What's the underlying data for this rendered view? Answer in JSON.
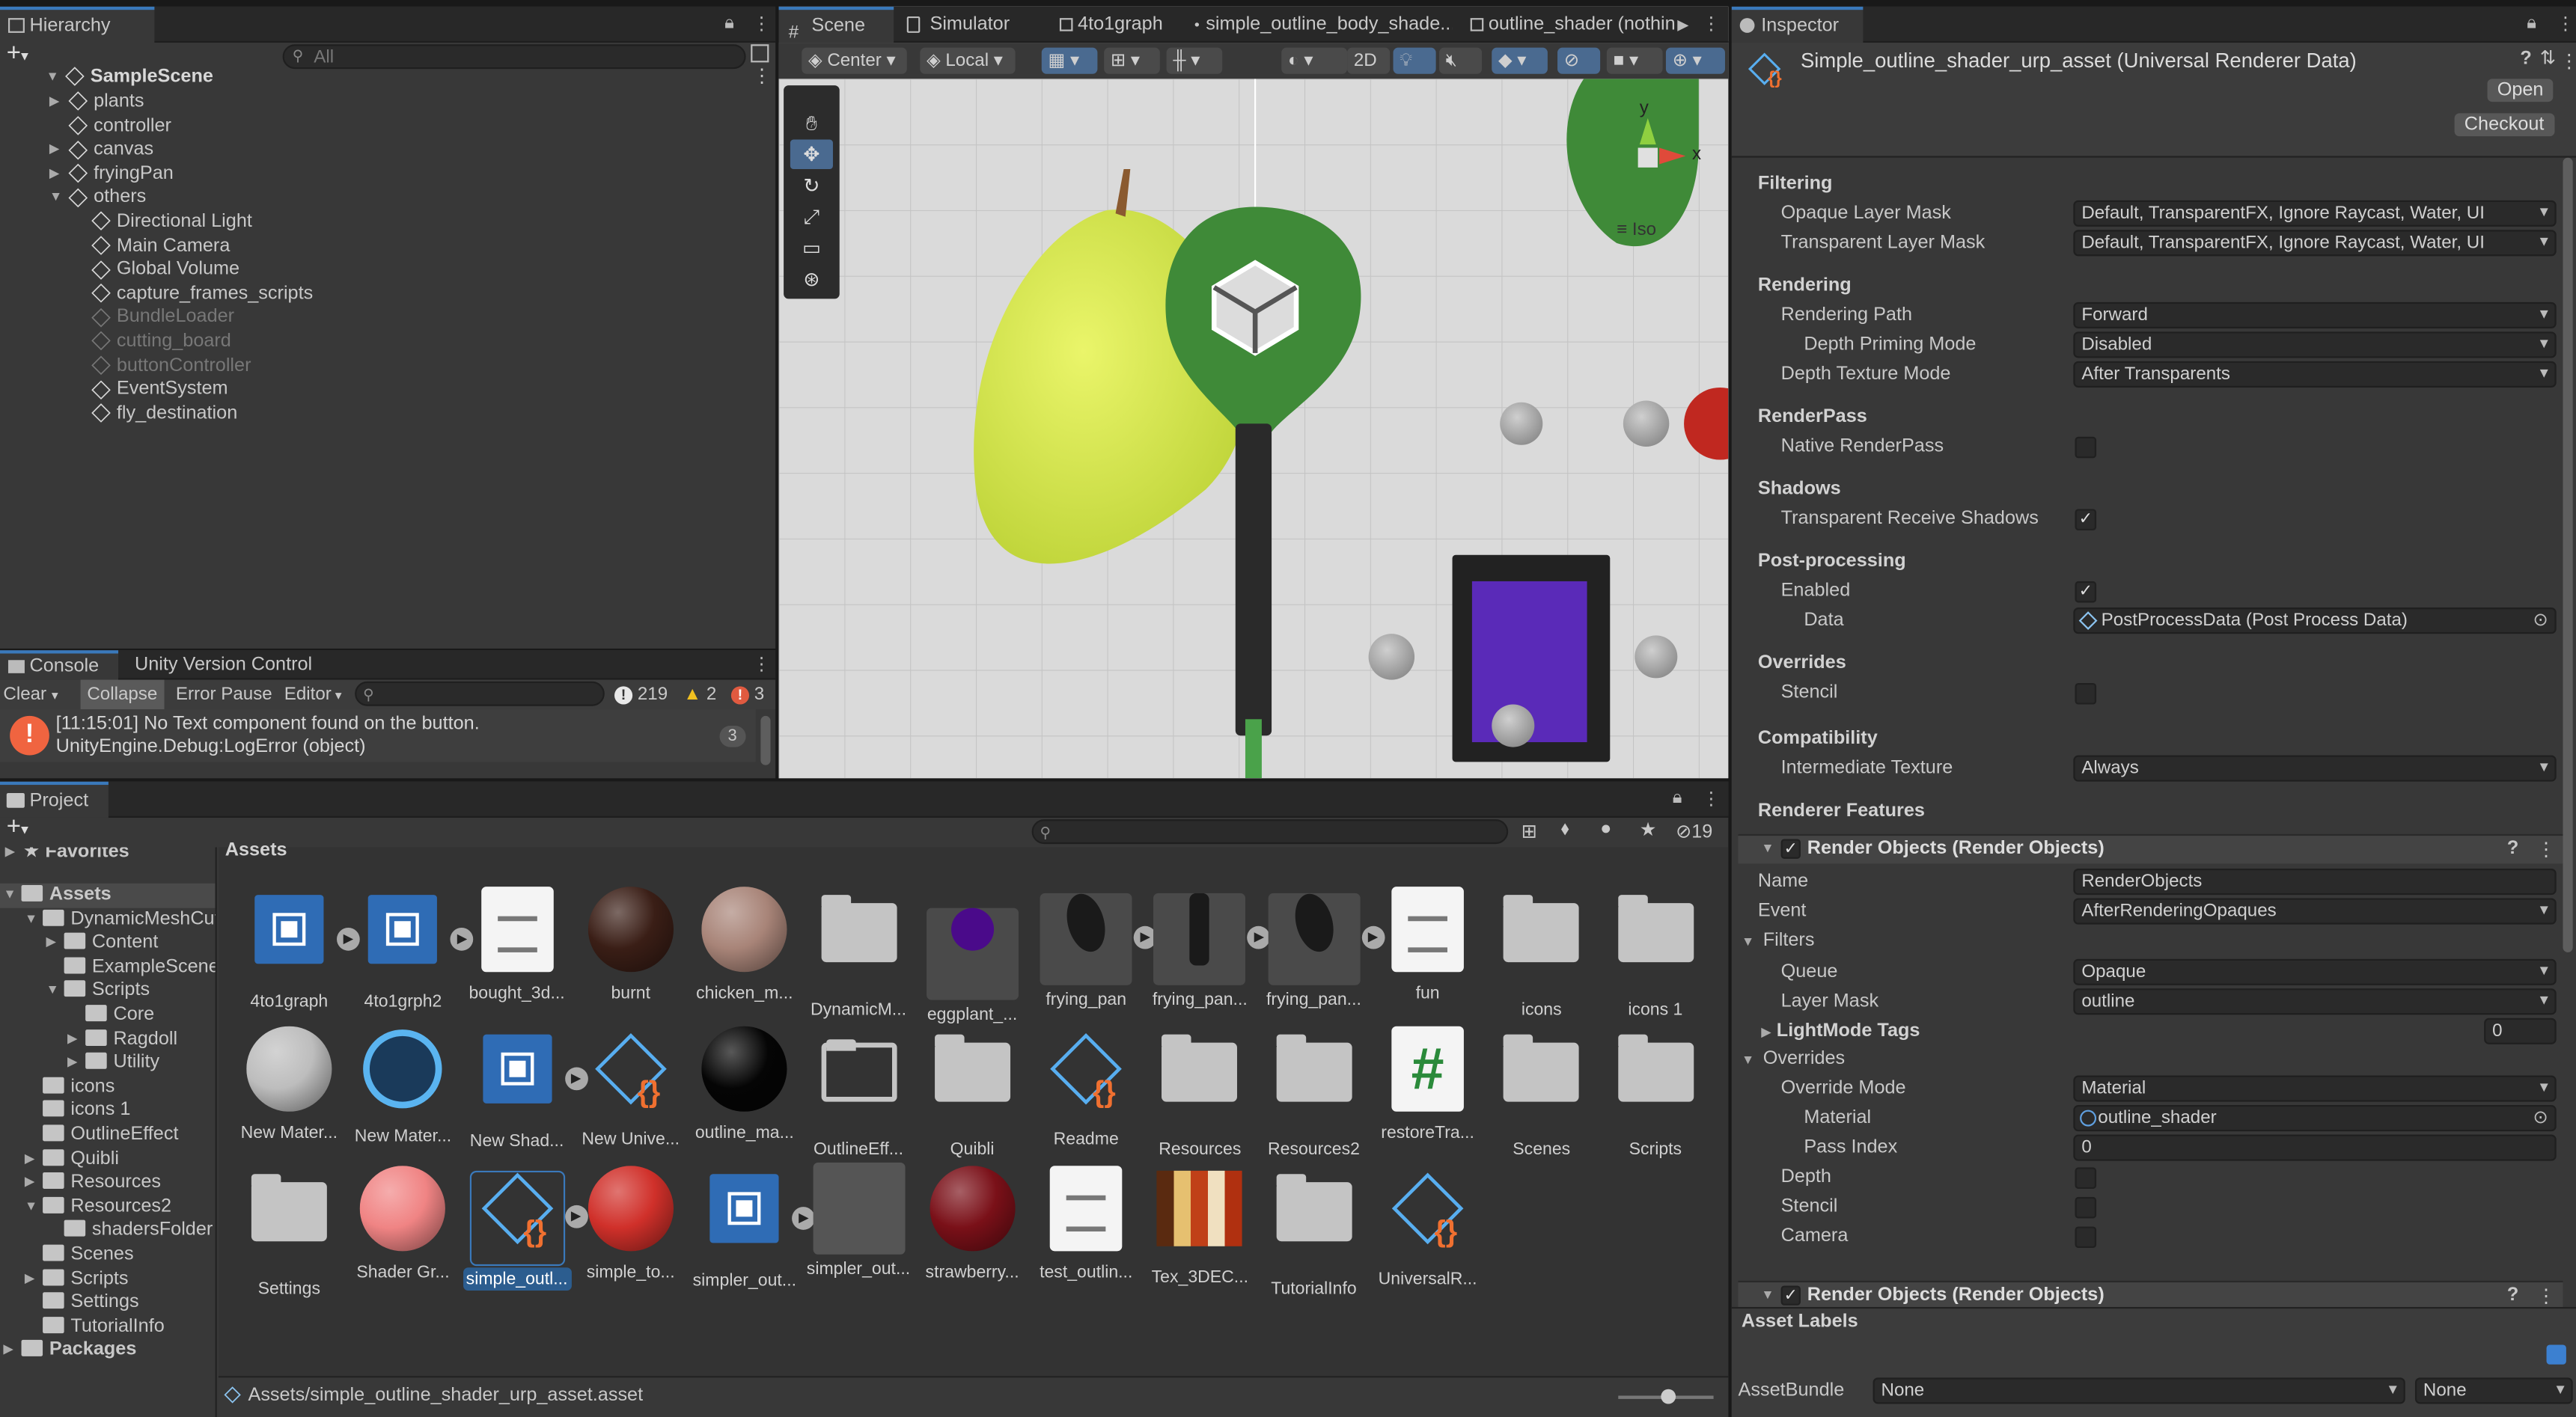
{
  "hierarchy": {
    "tab": "Hierarchy",
    "search_placeholder": "All",
    "scene": "SampleScene",
    "items": [
      {
        "label": "plants",
        "depth": 1,
        "expand": "▶",
        "dim": false
      },
      {
        "label": "controller",
        "depth": 1,
        "expand": "",
        "dim": false
      },
      {
        "label": "canvas",
        "depth": 1,
        "expand": "▶",
        "dim": false
      },
      {
        "label": "fryingPan",
        "depth": 1,
        "expand": "▶",
        "dim": false
      },
      {
        "label": "others",
        "depth": 1,
        "expand": "▼",
        "dim": false
      },
      {
        "label": "Directional Light",
        "depth": 2,
        "expand": "",
        "dim": false
      },
      {
        "label": "Main Camera",
        "depth": 2,
        "expand": "",
        "dim": false
      },
      {
        "label": "Global Volume",
        "depth": 2,
        "expand": "",
        "dim": false
      },
      {
        "label": "capture_frames_scripts",
        "depth": 2,
        "expand": "",
        "dim": false
      },
      {
        "label": "BundleLoader",
        "depth": 2,
        "expand": "",
        "dim": true
      },
      {
        "label": "cutting_board",
        "depth": 2,
        "expand": "",
        "dim": true
      },
      {
        "label": "buttonController",
        "depth": 2,
        "expand": "",
        "dim": true
      },
      {
        "label": "EventSystem",
        "depth": 2,
        "expand": "",
        "dim": false
      },
      {
        "label": "fly_destination",
        "depth": 2,
        "expand": "",
        "dim": false
      }
    ]
  },
  "console": {
    "tabs": [
      "Console",
      "Unity Version Control"
    ],
    "toolbar": {
      "clear": "Clear",
      "collapse": "Collapse",
      "error_pause": "Error Pause",
      "editor": "Editor"
    },
    "counts": {
      "info": "219",
      "warn": "2",
      "error": "3"
    },
    "message_line1": "[11:15:01] No Text component found on the button.",
    "message_line2": "UnityEngine.Debug:LogError (object)",
    "message_count": "3"
  },
  "scene_tabs": [
    "Scene",
    "Simulator",
    "4to1graph",
    "simple_outline_body_shade...",
    "outline_shader (nothin"
  ],
  "scene_toolbar": {
    "pivot": "Center",
    "space": "Local",
    "mode2d": "2D",
    "iso": "Iso",
    "axis_y": "y",
    "axis_x": "x"
  },
  "inspector": {
    "tab": "Inspector",
    "title": "Simple_outline_shader_urp_asset (Universal Renderer Data)",
    "open": "Open",
    "checkout": "Checkout",
    "filtering": "Filtering",
    "opaque_mask_label": "Opaque Layer Mask",
    "opaque_mask_value": "Default, TransparentFX, Ignore Raycast, Water, UI",
    "transparent_mask_label": "Transparent Layer Mask",
    "transparent_mask_value": "Default, TransparentFX, Ignore Raycast, Water, UI",
    "rendering": "Rendering",
    "rendering_path_label": "Rendering Path",
    "rendering_path_value": "Forward",
    "depth_priming_label": "Depth Priming Mode",
    "depth_priming_value": "Disabled",
    "depth_texture_label": "Depth Texture Mode",
    "depth_texture_value": "After Transparents",
    "renderpass": "RenderPass",
    "native_renderpass": "Native RenderPass",
    "shadows": "Shadows",
    "transparent_shadows": "Transparent Receive Shadows",
    "postprocessing": "Post-processing",
    "enabled": "Enabled",
    "data_label": "Data",
    "data_value": "PostProcessData (Post Process Data)",
    "overrides": "Overrides",
    "stencil": "Stencil",
    "compatibility": "Compatibility",
    "intermediate_label": "Intermediate Texture",
    "intermediate_value": "Always",
    "renderer_features": "Renderer Features",
    "feature1": "Render Objects (Render Objects)",
    "name_label": "Name",
    "name_value": "RenderObjects",
    "event_label": "Event",
    "event_value": "AfterRenderingOpaques",
    "filters": "Filters",
    "queue_label": "Queue",
    "queue_value": "Opaque",
    "layer_mask_label": "Layer Mask",
    "layer_mask_value": "outline",
    "lightmode": "LightMode Tags",
    "lightmode_value": "0",
    "overrides2": "Overrides",
    "override_mode_label": "Override Mode",
    "override_mode_value": "Material",
    "material_label": "Material",
    "material_value": "outline_shader",
    "pass_index_label": "Pass Index",
    "pass_index_value": "0",
    "depth": "Depth",
    "stencil2": "Stencil",
    "camera": "Camera",
    "feature2": "Render Objects (Render Objects)",
    "asset_labels": "Asset Labels",
    "assetbundle_label": "AssetBundle",
    "assetbundle_value": "None",
    "assetbundle_variant": "None"
  },
  "project": {
    "tab": "Project",
    "hidden_count": "19",
    "favorites": "Favorites",
    "breadcrumb": "Assets",
    "tree": [
      {
        "label": "Assets",
        "depth": 0,
        "expand": "▼",
        "bold": true
      },
      {
        "label": "DynamicMeshCut",
        "depth": 1,
        "expand": "▼",
        "bold": false
      },
      {
        "label": "Content",
        "depth": 2,
        "expand": "▶",
        "bold": false
      },
      {
        "label": "ExampleScene",
        "depth": 2,
        "expand": "",
        "bold": false
      },
      {
        "label": "Scripts",
        "depth": 2,
        "expand": "▼",
        "bold": false
      },
      {
        "label": "Core",
        "depth": 3,
        "expand": "",
        "bold": false
      },
      {
        "label": "Ragdoll",
        "depth": 3,
        "expand": "▶",
        "bold": false
      },
      {
        "label": "Utility",
        "depth": 3,
        "expand": "▶",
        "bold": false
      },
      {
        "label": "icons",
        "depth": 1,
        "expand": "",
        "bold": false
      },
      {
        "label": "icons 1",
        "depth": 1,
        "expand": "",
        "bold": false
      },
      {
        "label": "OutlineEffect",
        "depth": 1,
        "expand": "",
        "bold": false
      },
      {
        "label": "Quibli",
        "depth": 1,
        "expand": "▶",
        "bold": false
      },
      {
        "label": "Resources",
        "depth": 1,
        "expand": "▶",
        "bold": false
      },
      {
        "label": "Resources2",
        "depth": 1,
        "expand": "▼",
        "bold": false
      },
      {
        "label": "shadersFolder",
        "depth": 2,
        "expand": "",
        "bold": false
      },
      {
        "label": "Scenes",
        "depth": 1,
        "expand": "",
        "bold": false
      },
      {
        "label": "Scripts",
        "depth": 1,
        "expand": "▶",
        "bold": false
      },
      {
        "label": "Settings",
        "depth": 1,
        "expand": "",
        "bold": false
      },
      {
        "label": "TutorialInfo",
        "depth": 1,
        "expand": "",
        "bold": false
      },
      {
        "label": "Packages",
        "depth": 0,
        "expand": "▶",
        "bold": true
      }
    ],
    "assets": [
      {
        "label": "4to1graph",
        "kind": "graph",
        "play": true
      },
      {
        "label": "4to1grph2",
        "kind": "graph",
        "play": true
      },
      {
        "label": "bought_3d...",
        "kind": "doc",
        "play": false
      },
      {
        "label": "burnt",
        "kind": "sphere",
        "color": "#3a1e16",
        "play": false
      },
      {
        "label": "chicken_m...",
        "kind": "sphere",
        "color": "#a88478",
        "play": false
      },
      {
        "label": "DynamicM...",
        "kind": "folder",
        "play": false
      },
      {
        "label": "eggplant_...",
        "kind": "dot",
        "color": "#4a0a8a",
        "play": false
      },
      {
        "label": "frying_pan",
        "kind": "pan",
        "play": true
      },
      {
        "label": "frying_pan...",
        "kind": "tool",
        "play": true
      },
      {
        "label": "frying_pan...",
        "kind": "pan",
        "play": true
      },
      {
        "label": "fun",
        "kind": "doc",
        "play": false
      },
      {
        "label": "icons",
        "kind": "folder",
        "play": false
      },
      {
        "label": "icons 1",
        "kind": "folder",
        "play": false
      },
      {
        "label": "New Mater...",
        "kind": "sphere",
        "color": "#bdbdbd",
        "play": false
      },
      {
        "label": "New Mater...",
        "kind": "ring",
        "play": false
      },
      {
        "label": "New Shad...",
        "kind": "graph",
        "play": true
      },
      {
        "label": "New Unive...",
        "kind": "pcube",
        "play": false
      },
      {
        "label": "outline_ma...",
        "kind": "sphere",
        "color": "#050505",
        "play": false
      },
      {
        "label": "OutlineEff...",
        "kind": "ofolder",
        "play": false
      },
      {
        "label": "Quibli",
        "kind": "folder",
        "play": false
      },
      {
        "label": "Readme",
        "kind": "pcube",
        "play": false
      },
      {
        "label": "Resources",
        "kind": "folder",
        "play": false
      },
      {
        "label": "Resources2",
        "kind": "folder",
        "play": false
      },
      {
        "label": "restoreTra...",
        "kind": "hash",
        "play": false
      },
      {
        "label": "Scenes",
        "kind": "folder",
        "play": false
      },
      {
        "label": "Scripts",
        "kind": "folder",
        "play": false
      },
      {
        "label": "Settings",
        "kind": "folder",
        "play": false
      },
      {
        "label": "Shader Gr...",
        "kind": "sphere",
        "color": "#f08484",
        "play": false
      },
      {
        "label": "simple_outl...",
        "kind": "pcube",
        "play": true,
        "selected": true
      },
      {
        "label": "simple_to...",
        "kind": "sphere",
        "color": "#d0302a",
        "play": false
      },
      {
        "label": "simpler_out...",
        "kind": "graph",
        "play": true
      },
      {
        "label": "simpler_out...",
        "kind": "grey",
        "play": false
      },
      {
        "label": "strawberry...",
        "kind": "sphere",
        "color": "#7a1018",
        "play": false
      },
      {
        "label": "test_outlin...",
        "kind": "doc",
        "play": false
      },
      {
        "label": "Tex_3DEC...",
        "kind": "tex",
        "play": false
      },
      {
        "label": "TutorialInfo",
        "kind": "folder",
        "play": false
      },
      {
        "label": "UniversalR...",
        "kind": "pcube",
        "play": false
      }
    ],
    "status_path": "Assets/simple_outline_shader_urp_asset.asset"
  }
}
